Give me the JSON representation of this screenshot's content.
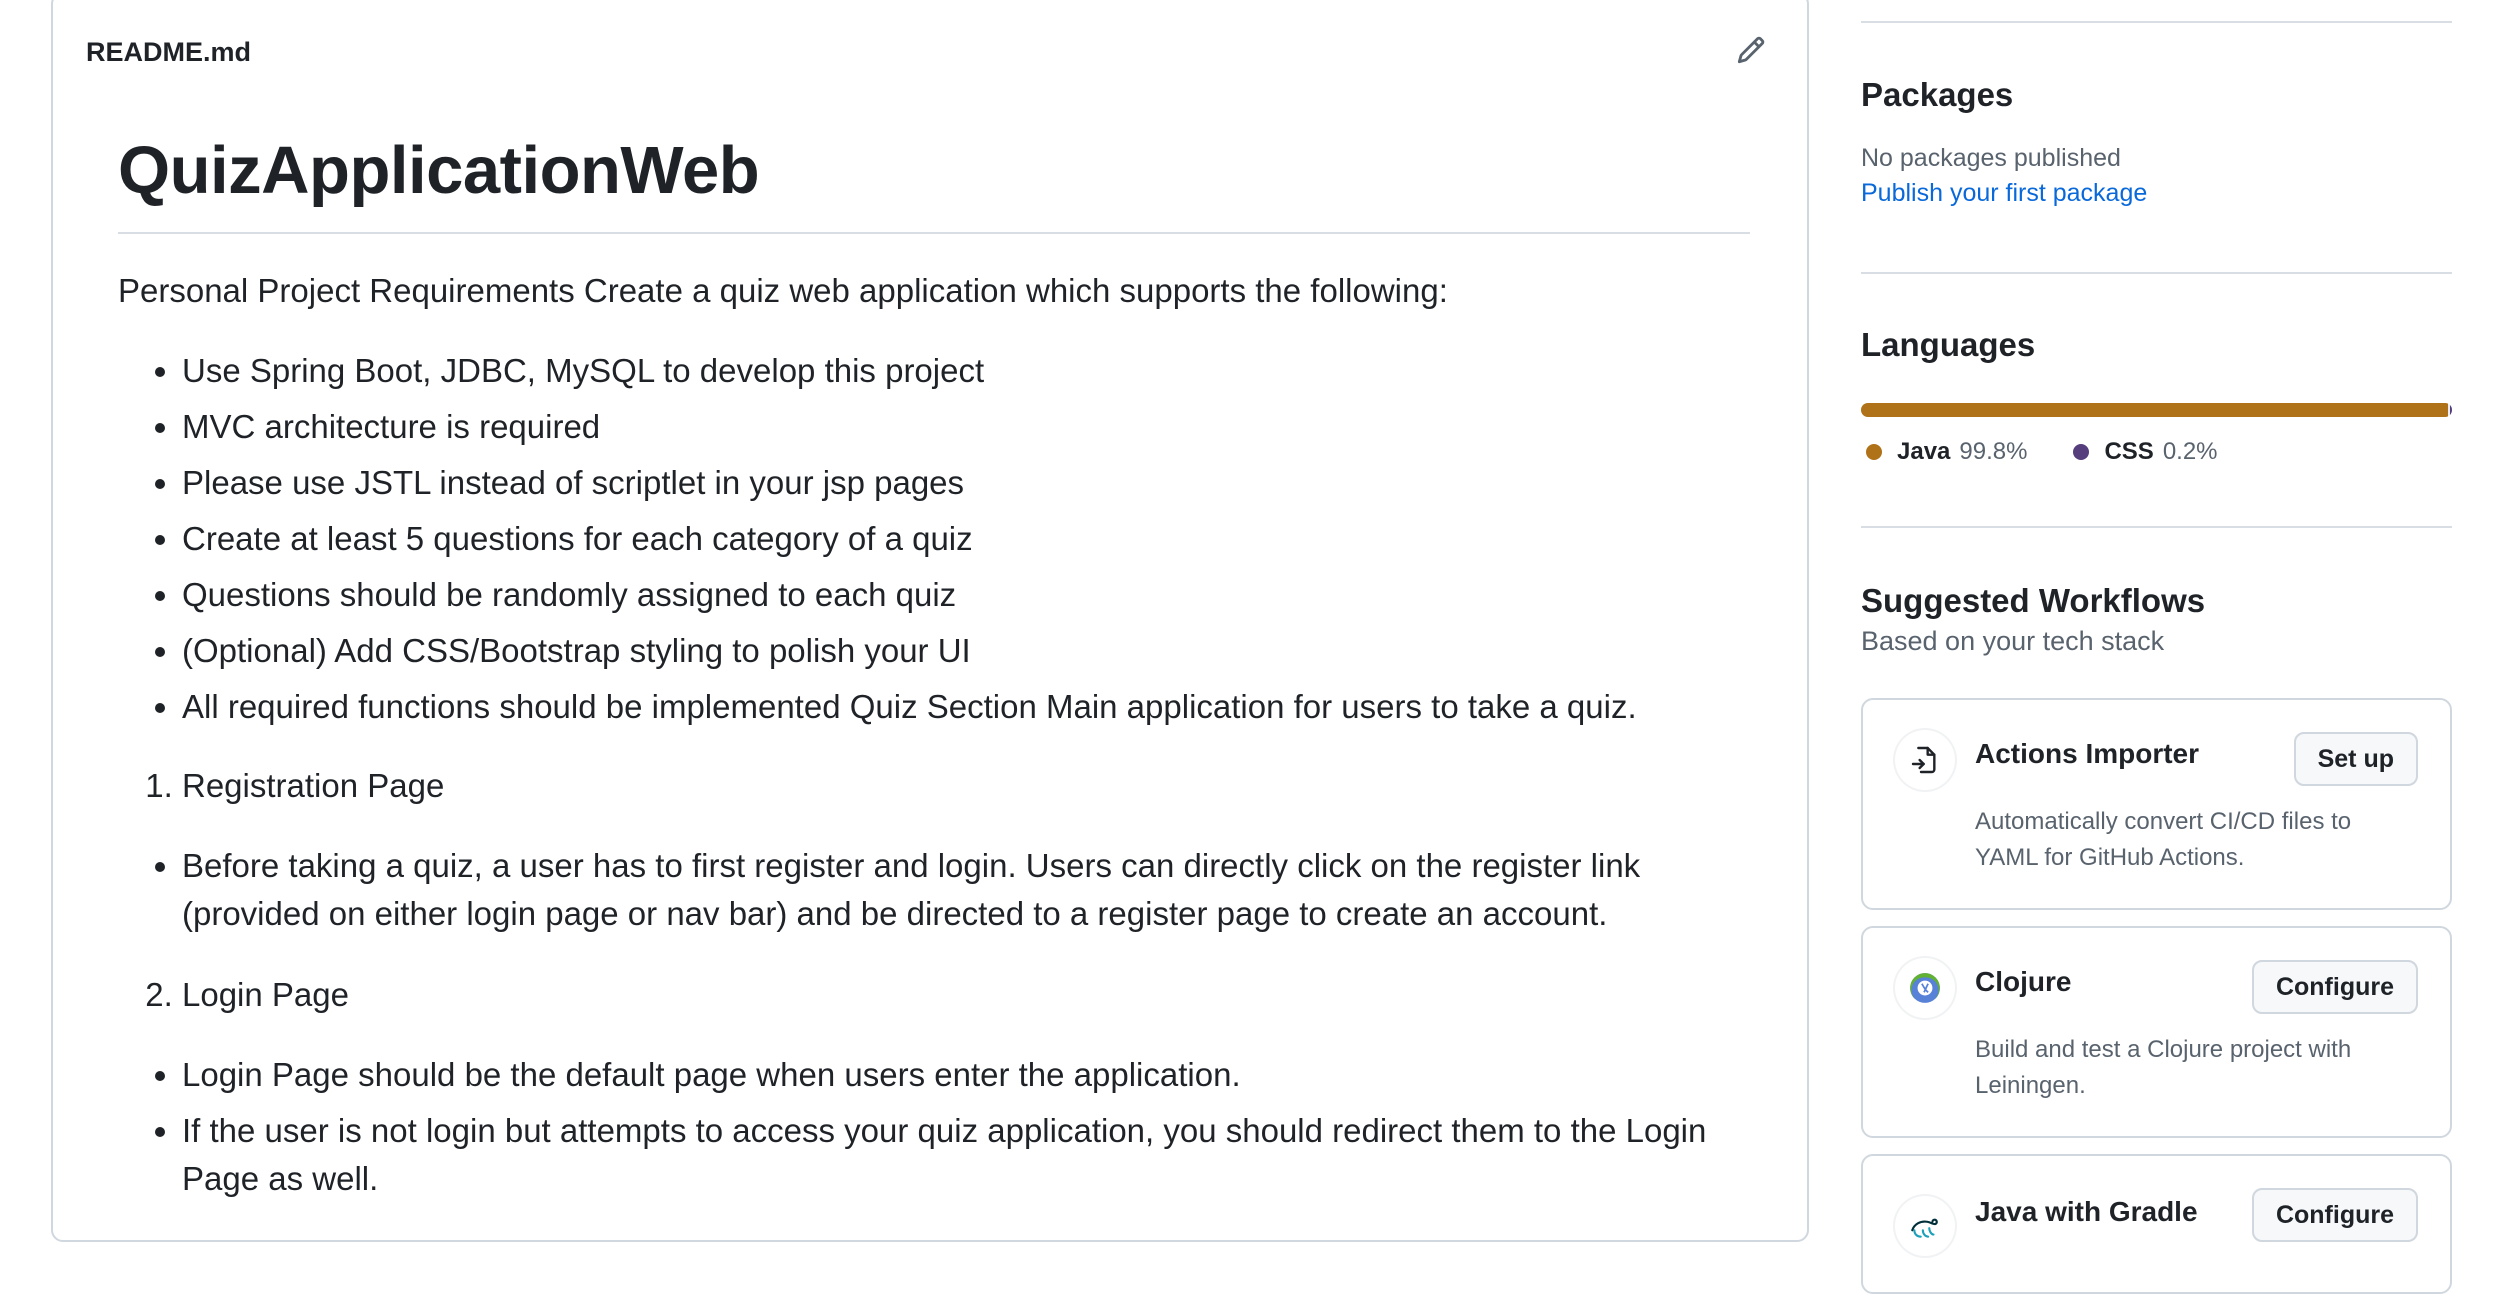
{
  "readme": {
    "filename": "README.md",
    "title": "QuizApplicationWeb",
    "intro": "Personal Project Requirements Create a quiz web application which supports the following:",
    "requirements": [
      "Use Spring Boot, JDBC, MySQL to develop this project",
      "MVC architecture is required",
      "Please use JSTL instead of scriptlet in your jsp pages",
      "Create at least 5 questions for each category of a quiz",
      "Questions should be randomly assigned to each quiz",
      "(Optional) Add CSS/Bootstrap styling to polish your UI",
      "All required functions should be implemented Quiz Section Main application for users to take a quiz."
    ],
    "section1": "Registration Page",
    "section1_items": [
      "Before taking a quiz, a user has to first register and login. Users can directly click on the register link (provided on either login page or nav bar) and be directed to a register page to create an account."
    ],
    "section2": "Login Page",
    "section2_items": [
      "Login Page should be the default page when users enter the application.",
      "If the user is not login but attempts to access your quiz application, you should redirect them to the Login Page as well."
    ]
  },
  "sidebar": {
    "packages": {
      "heading": "Packages",
      "empty": "No packages published",
      "link": "Publish your first package"
    },
    "languages": {
      "heading": "Languages",
      "items": [
        {
          "name": "Java",
          "percent": "99.8%",
          "share": 99.8,
          "color": "#b07219"
        },
        {
          "name": "CSS",
          "percent": "0.2%",
          "share": 0.2,
          "color": "#563d7c"
        }
      ]
    },
    "workflows": {
      "heading": "Suggested Workflows",
      "subheading": "Based on your tech stack",
      "cards": [
        {
          "name": "Actions Importer",
          "button": "Set up",
          "desc": "Automatically convert CI/CD files to YAML for GitHub Actions.",
          "icon": "actions-importer-icon"
        },
        {
          "name": "Clojure",
          "button": "Configure",
          "desc": "Build and test a Clojure project with Leiningen.",
          "icon": "clojure-icon"
        },
        {
          "name": "Java with Gradle",
          "button": "Configure",
          "desc": "",
          "icon": "gradle-icon"
        }
      ]
    }
  }
}
